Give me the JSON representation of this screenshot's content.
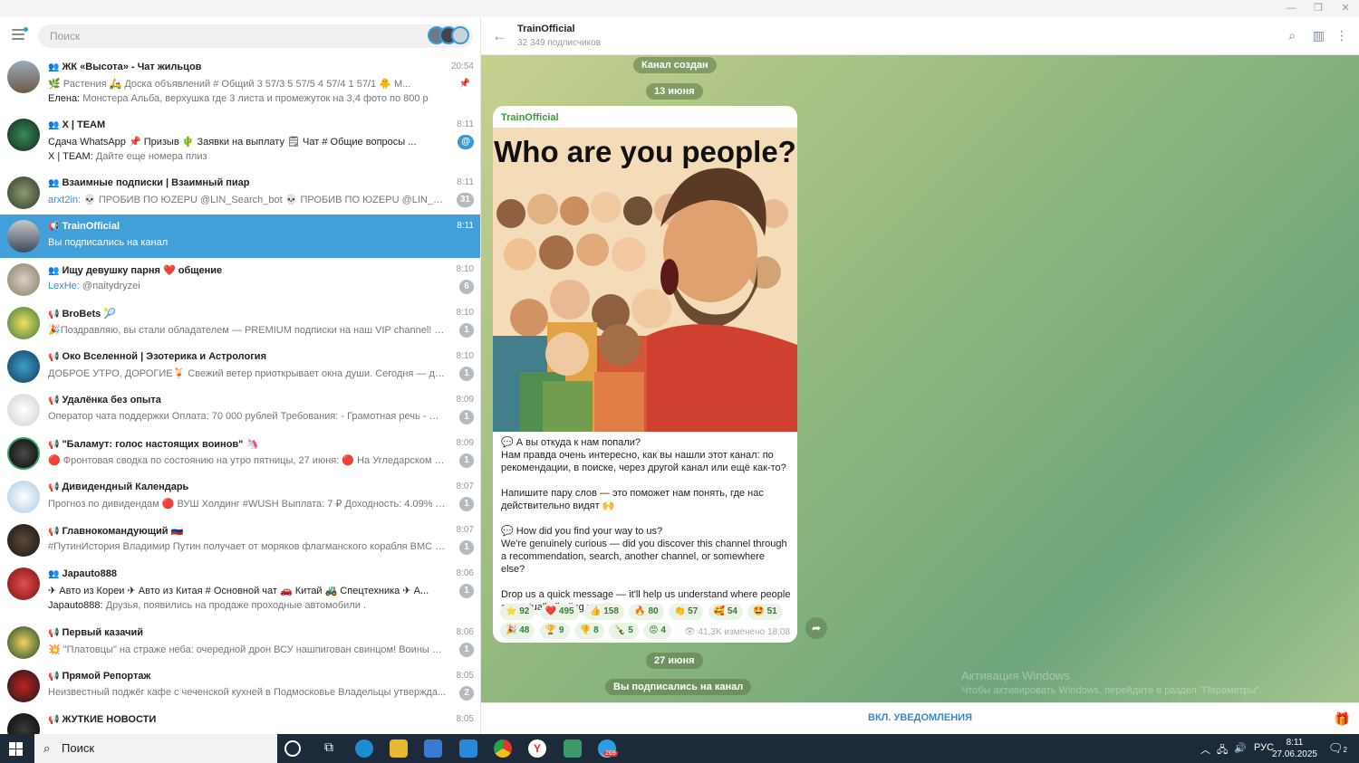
{
  "search": {
    "placeholder": "Поиск"
  },
  "chats": [
    {
      "name": "ЖК «Высота» - Чат жильцов",
      "time": "20:54",
      "line1": "🌿 Растения 🛵 Доска объявлений # Общий 3 57/3 5 57/5 4 57/4 1 57/1 🐥 М...",
      "sender": "Елена:",
      "line2": "Монстера Альба, верхушка где 3 листа и промежуток на 3,4 фото по 800 р",
      "type": "group"
    },
    {
      "name": "X | TEAM",
      "time": "8:11",
      "line1": "Сдача WhatsApp 📌 Призыв 🌵 Заявки на выплату 🗒 Чат # Общие вопросы ...",
      "sender": "X | TEAM:",
      "line2": "Дайте еще номера плиз",
      "type": "group"
    },
    {
      "name": "Взаимные подписки | Взаимный пиар",
      "time": "8:11",
      "sender": "arxt2in:",
      "line1": "💀 ПРОБИВ ПО ЮZEPU @LIN_Search_bot 💀 ПРОБИВ ПО ЮZEPU @LIN_Search_bot 💀 ПР...",
      "badge": "31",
      "type": "group"
    },
    {
      "name": "TrainOfficial",
      "time": "8:11",
      "line1": "Вы подписались на канал",
      "type": "channel"
    },
    {
      "name": "Ищу девушку парня ❤️ общение",
      "time": "8:10",
      "sender": "LexHe:",
      "line1": "@naitydryzei",
      "badge": "6",
      "type": "group"
    },
    {
      "name": "BroBets 🎾",
      "time": "8:10",
      "line1": "🎉Поздравляю, вы стали обладателем — PREMIUM подписки на наш VIP channel! Но ес...",
      "badge": "1",
      "type": "channel"
    },
    {
      "name": "Око Вселенной | Эзотерика и Астрология",
      "time": "8:10",
      "line1": "ДОБРОЕ УТРО, ДОРОГИЕ🍹 Свежий ветер приоткрывает окна души. Сегодня — день о...",
      "badge": "1",
      "type": "channel"
    },
    {
      "name": "Удалёнка без опыта",
      "time": "8:09",
      "line1": "Оператор чата поддержки Оплата: 70 000 рублей Требования: - Грамотная речь - Обуч...",
      "badge": "1",
      "type": "channel"
    },
    {
      "name": "\"Баламут: голос настоящих воинов\" 🦄",
      "time": "8:09",
      "line1": "🔴 Фронтовая сводка по состоянию на утро пятницы, 27 июня: 🔴 На Угледарском направ...",
      "badge": "1",
      "type": "channel"
    },
    {
      "name": "Дивидендный Календарь",
      "time": "8:07",
      "line1": "Прогноз по дивидендам 🔴 ВУШ Холдинг #WUSH Выплата: 7 ₽ Доходность: 4.09% Пери...",
      "badge": "1",
      "type": "channel"
    },
    {
      "name": "Главнокомандующий 🇷🇺",
      "time": "8:07",
      "line1": "#ПутинИстория Владимир Путин получает от моряков флагманского корабля ВМС Укр...",
      "badge": "1",
      "type": "channel"
    },
    {
      "name": "Japauto888",
      "time": "8:06",
      "line1": "✈ Авто из Кореи ✈ Авто из Китая # Основной чат 🚗 Китай 🚜 Спецтехника ✈ А...",
      "sender": "Japauto888:",
      "line2": "Друзья, появились на продаже проходные автомобили .",
      "badge": "1",
      "type": "group"
    },
    {
      "name": "Первый казачий",
      "time": "8:06",
      "line1": "💥 \"Платовцы\" на страже неба: очередной дрон ВСУ нашпигован свинцом! Воины 6-о...",
      "badge": "1",
      "type": "channel"
    },
    {
      "name": "Прямой Репортаж",
      "time": "8:05",
      "line1": "Неизвестный поджёг кафе с чеченской кухней в Подмосковье Владельцы утвержда...",
      "badge": "2",
      "type": "channel"
    },
    {
      "name": "ЖУТКИЕ НОВОСТИ",
      "time": "8:05",
      "line1": "",
      "badge": "",
      "type": "channel"
    }
  ],
  "channel": {
    "title": "TrainOfficial",
    "subscribers": "32 349 подписчиков",
    "pill_created": "Канал создан",
    "date1": "13 июня",
    "date2": "27 июня",
    "pill_subscribed": "Вы подписались на канал",
    "post": {
      "sender": "TrainOfficial",
      "image_title": "Who are you people?",
      "p1": "💬 А вы откуда к нам попали?\nНам правда очень интересно, как вы нашли этот канал: по рекомендации, в поиске, через другой канал или ещё как-то?",
      "p2": "Напишите пару слов — это поможет нам понять, где нас действительно видят 🙌",
      "p3": "💬 How did you find your way to us?\nWe're genuinely curious — did you discover this channel through a recommendation, search, another channel, or somewhere else?",
      "p4": "Drop us a quick message — it'll help us understand where people are actually finding us 🙌",
      "reactions": [
        "⭐ 92",
        "❤️ 495",
        "👍 158",
        "🔥 80",
        "👏 57",
        "🥰 54",
        "🤩 51",
        "🎉 48",
        "🏆 9",
        "👎 8",
        "🍾 5",
        "😡 4"
      ],
      "views": "41,3K",
      "edited": "изменено 18:08"
    },
    "notif_button": "ВКЛ. УВЕДОМЛЕНИЯ"
  },
  "watermark": {
    "line1": "Активация Windows",
    "line2": "Чтобы активировать Windows, перейдите в раздел \"Параметры\"."
  },
  "taskbar": {
    "search": "Поиск",
    "lang": "РУС",
    "time": "8:11",
    "date": "27.06.2025",
    "tg_badge": "269",
    "notif_count": "2"
  }
}
